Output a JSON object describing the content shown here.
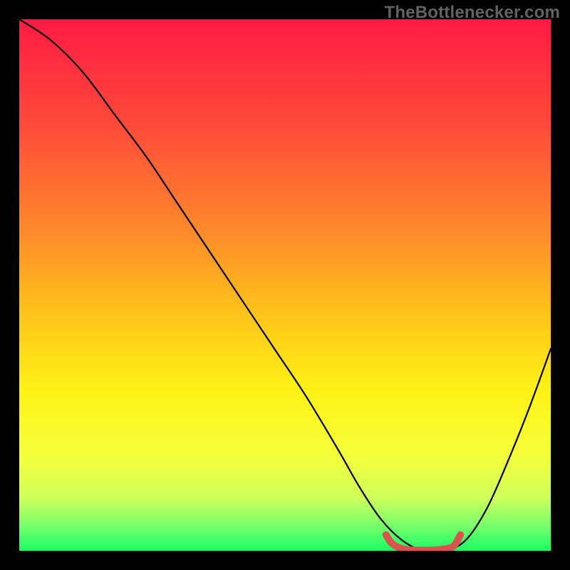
{
  "watermark": "TheBottlenecker.com",
  "chart_data": {
    "type": "line",
    "title": "",
    "xlabel": "",
    "ylabel": "",
    "xlim": [
      0,
      100
    ],
    "ylim": [
      0,
      100
    ],
    "series": [
      {
        "name": "bottleneck-curve",
        "x": [
          0,
          6,
          12,
          18,
          24,
          30,
          36,
          42,
          48,
          54,
          60,
          64,
          68,
          72,
          76,
          80,
          84,
          88,
          92,
          96,
          100
        ],
        "values": [
          100,
          96,
          90,
          82,
          74,
          65,
          56,
          47,
          38,
          29,
          19,
          12,
          6,
          2,
          0,
          0,
          2,
          8,
          17,
          27,
          38
        ]
      },
      {
        "name": "optimal-marker",
        "x": [
          69,
          70,
          71,
          72,
          73,
          75,
          77,
          79,
          81,
          82,
          83
        ],
        "values": [
          3,
          1.5,
          0.8,
          0.4,
          0.2,
          0.1,
          0.1,
          0.2,
          0.5,
          1.2,
          3
        ]
      }
    ],
    "gradient_stops": [
      {
        "pos": 0.0,
        "color": "#ff1a44"
      },
      {
        "pos": 0.2,
        "color": "#ff4a3a"
      },
      {
        "pos": 0.4,
        "color": "#ff8a2a"
      },
      {
        "pos": 0.55,
        "color": "#ffc21a"
      },
      {
        "pos": 0.7,
        "color": "#fff215"
      },
      {
        "pos": 0.82,
        "color": "#f5ff3a"
      },
      {
        "pos": 0.9,
        "color": "#d0ff5a"
      },
      {
        "pos": 0.95,
        "color": "#7dff6a"
      },
      {
        "pos": 1.0,
        "color": "#1aff66"
      }
    ],
    "curve_color": "#000000",
    "curve_width": 2.2,
    "marker_color": "#d9544f",
    "marker_width": 10
  }
}
